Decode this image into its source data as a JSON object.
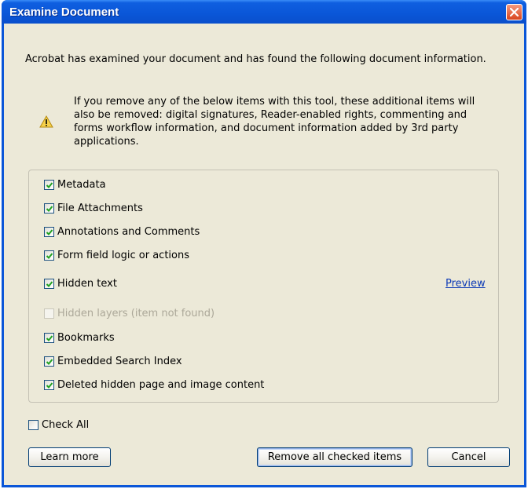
{
  "window": {
    "title": "Examine Document"
  },
  "intro_text": "Acrobat has examined your document and has found the following document information.",
  "warning": {
    "icon": "warning-icon",
    "lines": [
      "If you remove any of the below items with this tool, these additional items will",
      "also be removed: digital signatures, Reader-enabled rights, commenting and",
      "forms workflow information, and document information added by 3rd party",
      "applications."
    ]
  },
  "items": [
    {
      "label": "Metadata",
      "checked": true,
      "enabled": true
    },
    {
      "label": "File Attachments",
      "checked": true,
      "enabled": true
    },
    {
      "label": "Annotations and Comments",
      "checked": true,
      "enabled": true
    },
    {
      "label": "Form field logic or actions",
      "checked": true,
      "enabled": true
    },
    {
      "label": "Hidden text",
      "checked": true,
      "enabled": true
    },
    {
      "label": "Hidden layers (item not found)",
      "checked": false,
      "enabled": false
    },
    {
      "label": "Bookmarks",
      "checked": true,
      "enabled": true
    },
    {
      "label": "Embedded Search Index",
      "checked": true,
      "enabled": true
    },
    {
      "label": "Deleted hidden page and image content",
      "checked": true,
      "enabled": true
    }
  ],
  "preview_link": "Preview",
  "check_all": {
    "label": "Check All",
    "checked": false
  },
  "buttons": {
    "learn_more": "Learn more",
    "remove": "Remove all checked items",
    "cancel": "Cancel"
  },
  "colors": {
    "titlebar": "#0a56d8",
    "dialog_bg": "#ece9d8",
    "link": "#0b39b6",
    "check": "#21a121"
  }
}
